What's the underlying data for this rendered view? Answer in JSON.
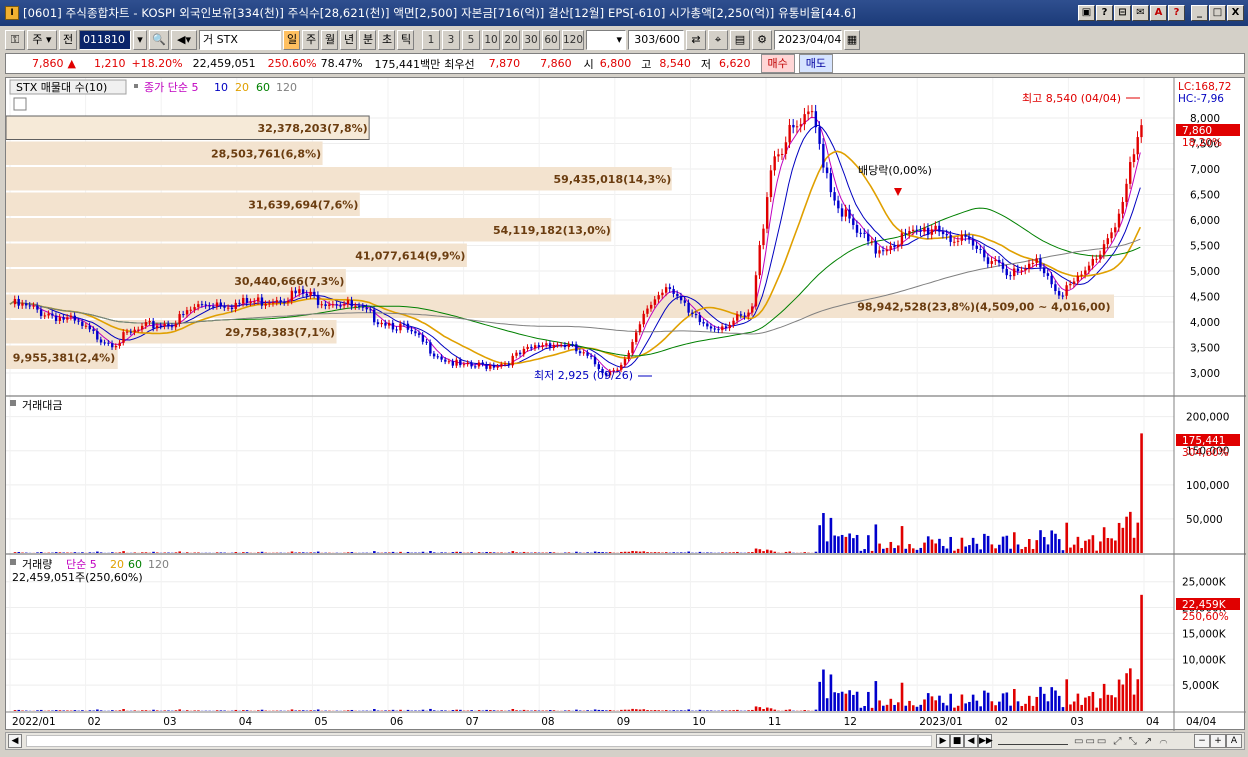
{
  "window": {
    "title": "[0601] 주식종합차트 - KOSPI 외국인보유[334(천)] 주식수[28,621(천)] 액면[2,500] 자본금[716(억)] 결산[12월] EPS[-610] 시가총액[2,250(억)] 유통비율[44.6]",
    "buttons": [
      "▣",
      "?",
      "⊟",
      "✉",
      "A",
      "?",
      "_",
      "□",
      "X"
    ]
  },
  "toolbar": {
    "market": "주",
    "all_label": "전",
    "code": "011810",
    "name": "거 STX",
    "periods": [
      "일",
      "주",
      "월",
      "년",
      "분",
      "초",
      "틱"
    ],
    "active_period": "일",
    "intervals": [
      "1",
      "3",
      "5",
      "10",
      "20",
      "30",
      "60",
      "120"
    ],
    "count": "303",
    "count_total": "/600",
    "date": "2023/04/04"
  },
  "quote": {
    "price": "7,860",
    "arrow": "▲",
    "change": "1,210",
    "change_pct": "+18.20%",
    "volume": "22,459,051",
    "volume_ratio": "250.60%",
    "turnover": "78.47%",
    "amount": "175,441백만",
    "preferred_label": "최우선",
    "ask": "7,870",
    "bid": "7,860",
    "open_label": "시",
    "open": "6,800",
    "high_label": "고",
    "high": "8,540",
    "low_label": "저",
    "low": "6,620",
    "buy_label": "매수",
    "sell_label": "매도"
  },
  "panels": {
    "price_title": "STX 매물대 수(10)",
    "ma_title": "종가 단순 5",
    "ma_periods": [
      "10",
      "20",
      "60",
      "120"
    ],
    "lc": "LC:168,72",
    "hc": "HC:-7,96",
    "high_note": "최고 8,540 (04/04)",
    "low_note": "최저 2,925 (09/26)",
    "dividend_note": "배당락(0,00%)",
    "price_tag": "7,860",
    "price_tag_pct": "18,20%",
    "amount_title": "거래대금",
    "amount_tag": "175,441",
    "amount_tag_pct": "304,60%",
    "volume_title": "거래량",
    "volume_ma": "단순 5",
    "volume_ma_periods": [
      "20",
      "60",
      "120"
    ],
    "volume_value": "22,459,051주(250,60%)",
    "volume_tag": "22,459K",
    "volume_tag_pct": "250,60%"
  },
  "chart_data": {
    "type": "candlestick",
    "price_axis": [
      "8,000",
      "7,500",
      "7,000",
      "6,500",
      "6,000",
      "5,500",
      "5,000",
      "4,500",
      "4,000",
      "3,500",
      "3,000"
    ],
    "amount_axis": [
      "200,000",
      "150,000",
      "100,000",
      "50,000"
    ],
    "volume_axis": [
      "25,000K",
      "20,000K",
      "15,000K",
      "10,000K",
      "5,000K"
    ],
    "x_labels": [
      "2022/01",
      "02",
      "03",
      "04",
      "05",
      "06",
      "07",
      "08",
      "09",
      "10",
      "11",
      "12",
      "2023/01",
      "02",
      "03",
      "04",
      "04/04"
    ],
    "volume_profile": [
      {
        "label": "32,378,203(7,8%)",
        "share": 7.8
      },
      {
        "label": "28,503,761(6,8%)",
        "share": 6.8
      },
      {
        "label": "59,435,018(14,3%)",
        "share": 14.3
      },
      {
        "label": "31,639,694(7,6%)",
        "share": 7.6
      },
      {
        "label": "54,119,182(13,0%)",
        "share": 13.0
      },
      {
        "label": "41,077,614(9,9%)",
        "share": 9.9
      },
      {
        "label": "30,440,666(7,3%)",
        "share": 7.3
      },
      {
        "label": "98,942,528(23,8%)(4,509,00 ~ 4,016,00)",
        "share": 23.8
      },
      {
        "label": "29,758,383(7,1%)",
        "share": 7.1
      },
      {
        "label": "9,955,381(2,4%)",
        "share": 2.4
      }
    ],
    "price_path": [
      4350,
      4250,
      4150,
      4000,
      3750,
      3600,
      3800,
      3950,
      4000,
      4300,
      4400,
      4350,
      4400,
      4500,
      4550,
      4450,
      4400,
      4200,
      4050,
      3900,
      3600,
      3300,
      3100,
      3150,
      3200,
      3400,
      3600,
      3550,
      3300,
      3000,
      3300,
      4300,
      4800,
      4100,
      3900,
      4000,
      4100,
      7200,
      7700,
      8000,
      6500,
      5800,
      5400,
      5600,
      5700,
      5900,
      5600,
      5400,
      5200,
      4900,
      5200,
      4600,
      4800,
      5400,
      6200,
      7860
    ],
    "volume_profile_bands": [
      8000,
      7500,
      7000,
      6500,
      6000,
      5500,
      5000,
      4500,
      4000,
      3500
    ]
  },
  "statusbar": {
    "scroll_left": "◀",
    "controls": [
      "▶",
      "■",
      "◀",
      "▶▶"
    ],
    "zoom": [
      "−",
      "+",
      "A"
    ]
  },
  "colors": {
    "up": "#e00000",
    "down": "#0000cc",
    "profile": "#f3e3cf",
    "ma5": "#c000c0",
    "ma10": "#0000c0",
    "ma20": "#e0a000",
    "ma60": "#008000",
    "ma120": "#808080"
  }
}
